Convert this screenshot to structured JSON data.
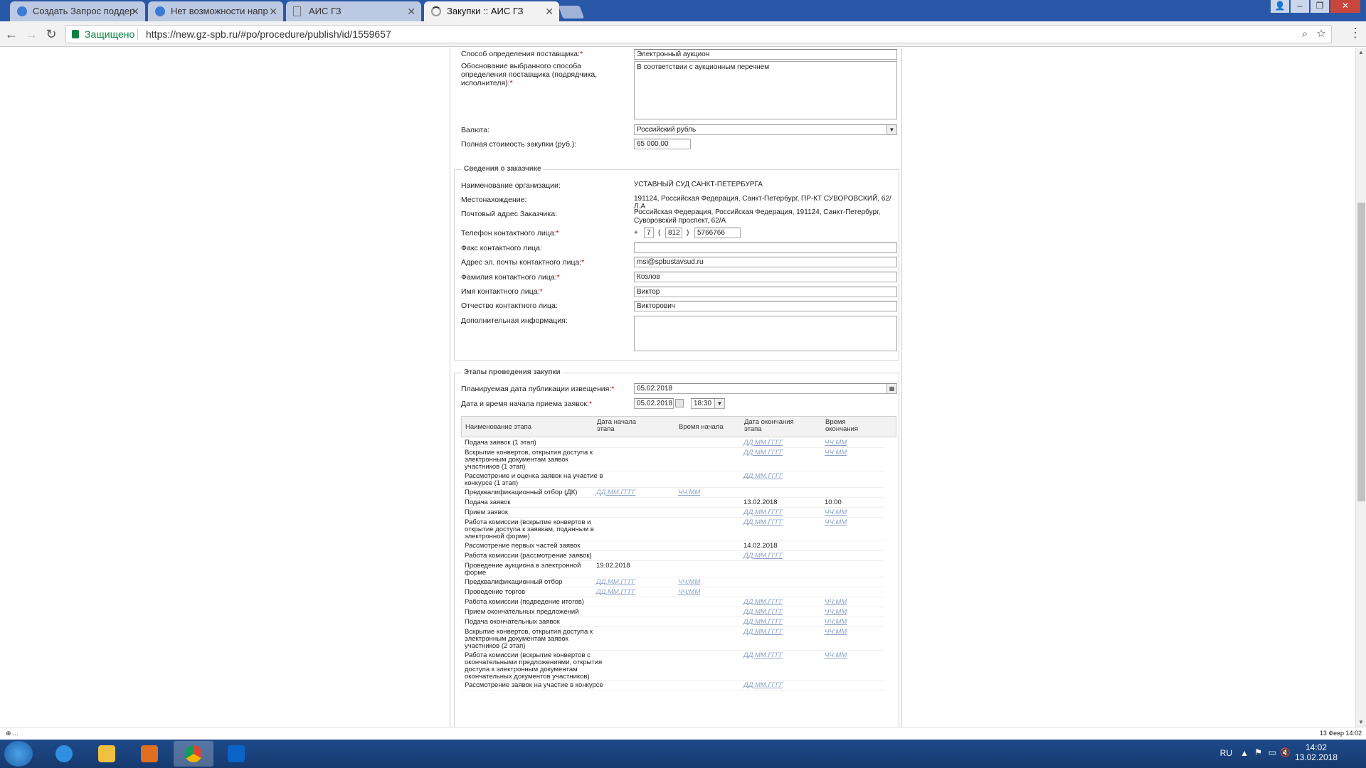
{
  "browser": {
    "tabs": [
      {
        "title": "Создать Запрос поддер",
        "icon": "helpdesk-icon"
      },
      {
        "title": "Нет возможности напр",
        "icon": "helpdesk-icon"
      },
      {
        "title": "АИС ГЗ",
        "icon": "document-icon"
      },
      {
        "title": "Закупки :: АИС ГЗ",
        "icon": "loading-icon",
        "active": true
      }
    ],
    "secure_label": "Защищено",
    "url": "https://new.gz-spb.ru/#po/procedure/publish/id/1559657"
  },
  "procurement": {
    "method_label": "Способ определения поставщика:",
    "method_value": "Электронный аукцион",
    "justification_label": "Обоснование выбранного способа определения поставщика (подрядчика, исполнителя):",
    "justification_value": "В соответствии с аукционным перечнем",
    "currency_label": "Валюта:",
    "currency_value": "Российский рубль",
    "total_label": "Полная стоимость закупки (руб.):",
    "total_value": "65 000,00"
  },
  "customer": {
    "legend": "Сведения о заказчике",
    "org_label": "Наименование организации:",
    "org_value": "УСТАВНЫЙ СУД САНКТ-ПЕТЕРБУРГА",
    "location_label": "Местонахождение:",
    "location_value": "191124, Российская Федерация, Санкт-Петербург, ПР-КТ СУВОРОВСКИЙ, 62/Л.А",
    "postal_label": "Почтовый адрес Заказчика:",
    "postal_value_1": "Российская Федерация, Российская Федерация, 191124, Санкт-Петербург,",
    "postal_value_2": "Суворовский проспект, 62/А",
    "phone_label": "Телефон контактного лица:",
    "phone_plus": "+",
    "phone_country": "7",
    "phone_code": "812",
    "phone_number": "5766766",
    "fax_label": "Факс контактного лица:",
    "email_label": "Адрес эл. почты контактного лица:",
    "email_value": "msi@spbustavsud.ru",
    "surname_label": "Фамилия контактного лица:",
    "surname_value": "Козлов",
    "name_label": "Имя контактного лица:",
    "name_value": "Виктор",
    "patronymic_label": "Отчество контактного лица:",
    "patronymic_value": "Викторович",
    "extra_label": "Дополнительная информация:"
  },
  "stages": {
    "legend": "Этапы проведения закупки",
    "pub_date_label": "Планируемая дата публикации извещения:",
    "pub_date_value": "05.02.2018",
    "start_label": "Дата и время начала приема заявок:",
    "start_date": "05.02.2018",
    "start_time": "18:30",
    "columns": [
      "Наименование этапа",
      "Дата начала этапа",
      "Время начала",
      "Дата окончания этапа",
      "Время окончания"
    ],
    "rows": [
      {
        "name": [
          "Подача заявок (1 этап)"
        ],
        "ds": "",
        "ts": "",
        "de": "ДД.ММ.ГГГГ",
        "te": "ЧЧ:ММ"
      },
      {
        "name": [
          "Вскрытие конвертов, открытия доступа к",
          "электронным документам заявок",
          "участников (1 этап)"
        ],
        "ds": "",
        "ts": "",
        "de": "ДД.ММ.ГГГГ",
        "te": "ЧЧ:ММ"
      },
      {
        "name": [
          "Рассмотрение и оценка заявок на участие в",
          "конкурсе (1 этап)"
        ],
        "ds": "",
        "ts": "",
        "de": "ДД.ММ.ГГГГ",
        "te": ""
      },
      {
        "name": [
          "Предквалификационный отбор (ДК)"
        ],
        "ds": "ДД.ММ.ГГГГ",
        "ts": "ЧЧ:ММ",
        "de": "",
        "te": ""
      },
      {
        "name": [
          "Подача заявок"
        ],
        "ds": "",
        "ts": "",
        "de": "13.02.2018",
        "te": "10:00"
      },
      {
        "name": [
          "Прием заявок"
        ],
        "ds": "",
        "ts": "",
        "de": "ДД.ММ.ГГГГ",
        "te": "ЧЧ:ММ"
      },
      {
        "name": [
          "Работа комиссии (вскрытие конвертов и",
          "открытие доступа к заявкам, поданным в",
          "электронной форме)"
        ],
        "ds": "",
        "ts": "",
        "de": "ДД.ММ.ГГГГ",
        "te": "ЧЧ:ММ"
      },
      {
        "name": [
          "Рассмотрение первых частей заявок"
        ],
        "ds": "",
        "ts": "",
        "de": "14.02.2018",
        "te": ""
      },
      {
        "name": [
          "Работа комиссии (рассмотрение заявок)"
        ],
        "ds": "",
        "ts": "",
        "de": "ДД.ММ.ГГГГ",
        "te": ""
      },
      {
        "name": [
          "Проведение аукциона в электронной",
          "форме"
        ],
        "ds": "19.02.2018",
        "ts": "",
        "de": "",
        "te": ""
      },
      {
        "name": [
          "Предквалификационный отбор"
        ],
        "ds": "ДД.ММ.ГГГГ",
        "ts": "ЧЧ:ММ",
        "de": "",
        "te": ""
      },
      {
        "name": [
          "Проведение торгов"
        ],
        "ds": "ДД.ММ.ГГГГ",
        "ts": "ЧЧ:ММ",
        "de": "",
        "te": ""
      },
      {
        "name": [
          "Работа комиссии (подведение итогов)"
        ],
        "ds": "",
        "ts": "",
        "de": "ДД.ММ.ГГГГ",
        "te": "ЧЧ:ММ"
      },
      {
        "name": [
          "Прием окончательных предложений"
        ],
        "ds": "",
        "ts": "",
        "de": "ДД.ММ.ГГГГ",
        "te": "ЧЧ:ММ"
      },
      {
        "name": [
          "Подача окончательных заявок"
        ],
        "ds": "",
        "ts": "",
        "de": "ДД.ММ.ГГГГ",
        "te": "ЧЧ:ММ"
      },
      {
        "name": [
          "Вскрытие конвертов, открытия доступа к",
          "электронным документам заявок",
          "участников (2 этап)"
        ],
        "ds": "",
        "ts": "",
        "de": "ДД.ММ.ГГГГ",
        "te": "ЧЧ:ММ"
      },
      {
        "name": [
          "Работа комиссии (вскрытие конвертов с",
          "окончательными предложениями, открытия",
          "доступа к электронным документам",
          "окончательных документов участников)"
        ],
        "ds": "",
        "ts": "",
        "de": "ДД.ММ.ГГГГ",
        "te": "ЧЧ:ММ"
      },
      {
        "name": [
          "Рассмотрение заявок на участие в конкурсе"
        ],
        "ds": "",
        "ts": "",
        "de": "ДД.ММ.ГГГГ",
        "te": ""
      }
    ]
  },
  "statusbar": {
    "left": "⊕ ...",
    "right": "13 Февр 14:02"
  },
  "taskbar": {
    "lang": "RU",
    "time": "14:02",
    "date": "13.02.2018"
  }
}
